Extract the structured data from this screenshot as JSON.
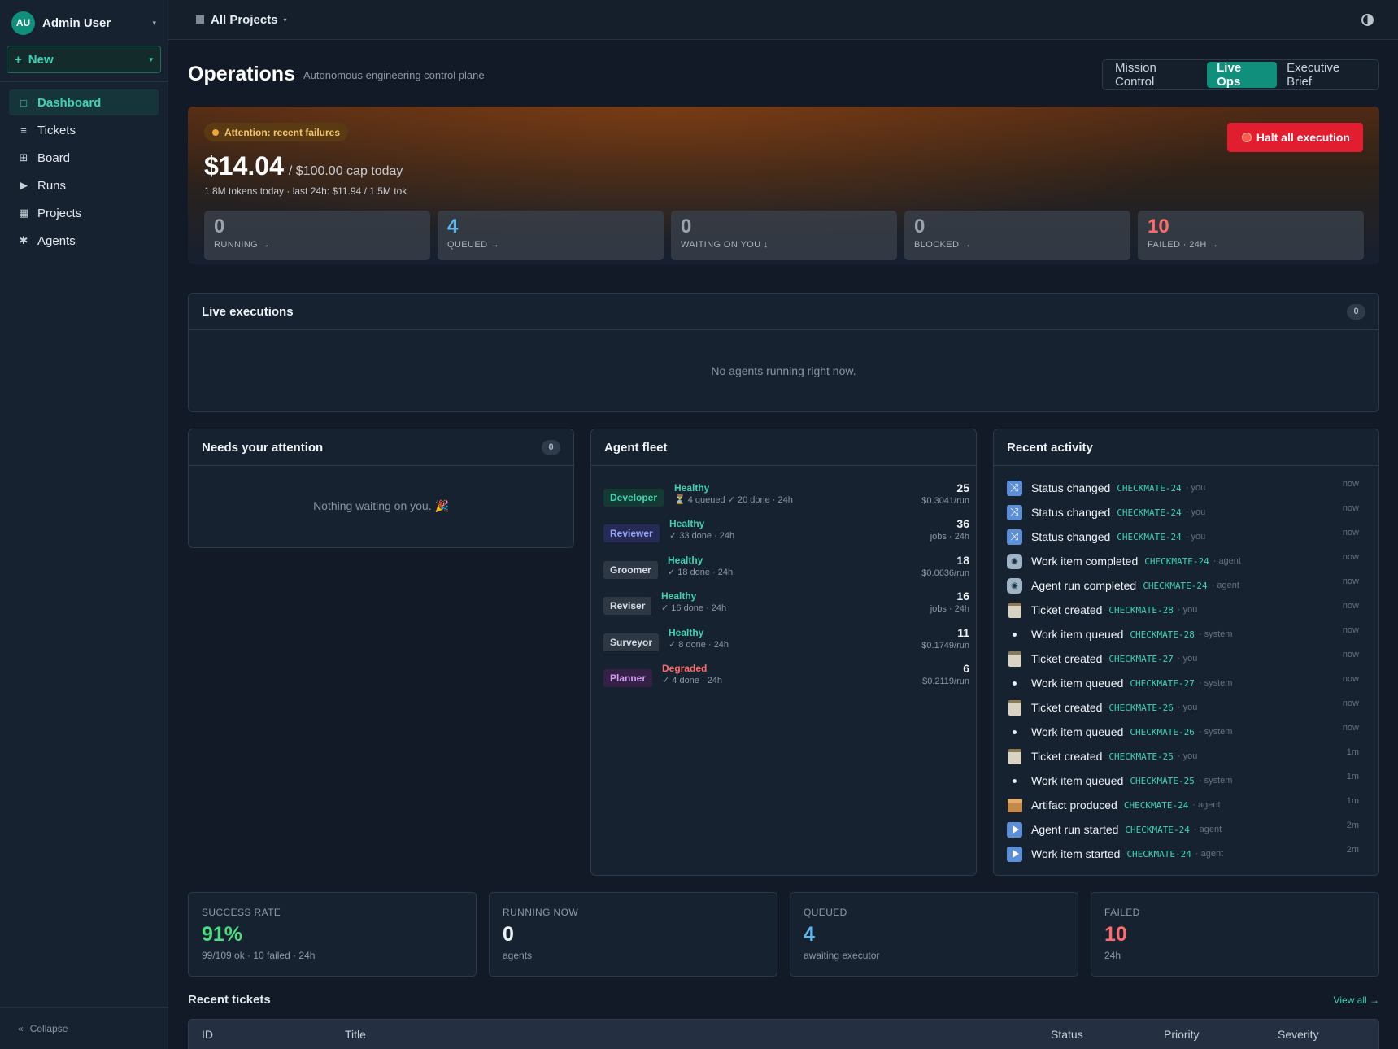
{
  "user": {
    "initials": "AU",
    "name": "Admin User"
  },
  "new_button": "New",
  "nav": [
    {
      "label": "Dashboard",
      "icon": "square-icon",
      "glyph": "□",
      "active": true
    },
    {
      "label": "Tickets",
      "icon": "list-icon",
      "glyph": "≡"
    },
    {
      "label": "Board",
      "icon": "grid-icon",
      "glyph": "⊞"
    },
    {
      "label": "Runs",
      "icon": "play-icon",
      "glyph": "▶"
    },
    {
      "label": "Projects",
      "icon": "table-icon",
      "glyph": "▦"
    },
    {
      "label": "Agents",
      "icon": "asterisk-icon",
      "glyph": "✱"
    }
  ],
  "collapse_label": "Collapse",
  "project_selector": "All Projects",
  "page": {
    "title": "Operations",
    "subtitle": "Autonomous engineering control plane"
  },
  "view_tabs": [
    "Mission Control",
    "Live Ops",
    "Executive Brief"
  ],
  "hero": {
    "attention": "Attention: recent failures",
    "cost": "$14.04",
    "cap": "/ $100.00 cap today",
    "tokens": "1.8M tokens today  ·  last 24h: $11.94 / 1.5M tok",
    "halt_label": "Halt all execution",
    "stats": [
      {
        "value": "0",
        "label": "RUNNING →"
      },
      {
        "value": "4",
        "label": "QUEUED →"
      },
      {
        "value": "0",
        "label": "WAITING ON YOU ↓"
      },
      {
        "value": "0",
        "label": "BLOCKED →"
      },
      {
        "value": "10",
        "label": "FAILED · 24H →"
      }
    ]
  },
  "live_executions": {
    "title": "Live executions",
    "count": "0",
    "empty": "No agents running right now."
  },
  "attention_card": {
    "title": "Needs your attention",
    "count": "0",
    "empty": "Nothing waiting on you. 🎉"
  },
  "fleet": {
    "title": "Agent fleet",
    "agents": [
      {
        "role": "Developer",
        "status": "Healthy",
        "meta": "⏳ 4 queued  ✓ 20 done · 24h",
        "count": "25",
        "sub": "$0.3041/run"
      },
      {
        "role": "Reviewer",
        "status": "Healthy",
        "meta": "✓ 33 done · 24h",
        "count": "36",
        "sub": "jobs · 24h"
      },
      {
        "role": "Groomer",
        "status": "Healthy",
        "meta": "✓ 18 done · 24h",
        "count": "18",
        "sub": "$0.0636/run"
      },
      {
        "role": "Reviser",
        "status": "Healthy",
        "meta": "✓ 16 done · 24h",
        "count": "16",
        "sub": "jobs · 24h"
      },
      {
        "role": "Surveyor",
        "status": "Healthy",
        "meta": "✓ 8 done · 24h",
        "count": "11",
        "sub": "$0.1749/run"
      },
      {
        "role": "Planner",
        "status": "Degraded",
        "meta": "✓ 4 done · 24h",
        "count": "6",
        "sub": "$0.2119/run"
      }
    ]
  },
  "activity": {
    "title": "Recent activity",
    "items": [
      {
        "icon": "shuffle-icon",
        "text": "Status changed",
        "key": "CHECKMATE-24",
        "who": "· you",
        "when": "now"
      },
      {
        "icon": "shuffle-icon",
        "text": "Status changed",
        "key": "CHECKMATE-24",
        "who": "· you",
        "when": "now"
      },
      {
        "icon": "shuffle-icon",
        "text": "Status changed",
        "key": "CHECKMATE-24",
        "who": "· you",
        "when": "now"
      },
      {
        "icon": "robot-icon",
        "text": "Work item completed",
        "key": "CHECKMATE-24",
        "who": "· agent",
        "when": "now"
      },
      {
        "icon": "robot-icon",
        "text": "Agent run completed",
        "key": "CHECKMATE-24",
        "who": "· agent",
        "when": "now"
      },
      {
        "icon": "clipboard-icon",
        "text": "Ticket created",
        "key": "CHECKMATE-28",
        "who": "· you",
        "when": "now"
      },
      {
        "icon": "dot-icon",
        "text": "Work item queued",
        "key": "CHECKMATE-28",
        "who": "· system",
        "when": "now"
      },
      {
        "icon": "clipboard-icon",
        "text": "Ticket created",
        "key": "CHECKMATE-27",
        "who": "· you",
        "when": "now"
      },
      {
        "icon": "dot-icon",
        "text": "Work item queued",
        "key": "CHECKMATE-27",
        "who": "· system",
        "when": "now"
      },
      {
        "icon": "clipboard-icon",
        "text": "Ticket created",
        "key": "CHECKMATE-26",
        "who": "· you",
        "when": "now"
      },
      {
        "icon": "dot-icon",
        "text": "Work item queued",
        "key": "CHECKMATE-26",
        "who": "· system",
        "when": "now"
      },
      {
        "icon": "clipboard-icon",
        "text": "Ticket created",
        "key": "CHECKMATE-25",
        "who": "· you",
        "when": "1m"
      },
      {
        "icon": "dot-icon",
        "text": "Work item queued",
        "key": "CHECKMATE-25",
        "who": "· system",
        "when": "1m"
      },
      {
        "icon": "package-icon",
        "text": "Artifact produced",
        "key": "CHECKMATE-24",
        "who": "· agent",
        "when": "1m"
      },
      {
        "icon": "play-icon",
        "text": "Agent run started",
        "key": "CHECKMATE-24",
        "who": "· agent",
        "when": "2m"
      },
      {
        "icon": "play-icon",
        "text": "Work item started",
        "key": "CHECKMATE-24",
        "who": "· agent",
        "when": "2m"
      }
    ]
  },
  "kpis": [
    {
      "label": "SUCCESS RATE",
      "value": "91%",
      "sub": "99/109 ok · 10 failed · 24h"
    },
    {
      "label": "RUNNING NOW",
      "value": "0",
      "sub": "agents"
    },
    {
      "label": "QUEUED",
      "value": "4",
      "sub": "awaiting executor"
    },
    {
      "label": "FAILED",
      "value": "10",
      "sub": "24h"
    }
  ],
  "recent_tickets": {
    "title": "Recent tickets",
    "view_all": "View all →",
    "columns": [
      "ID",
      "Title",
      "Status",
      "Priority",
      "Severity"
    ]
  }
}
